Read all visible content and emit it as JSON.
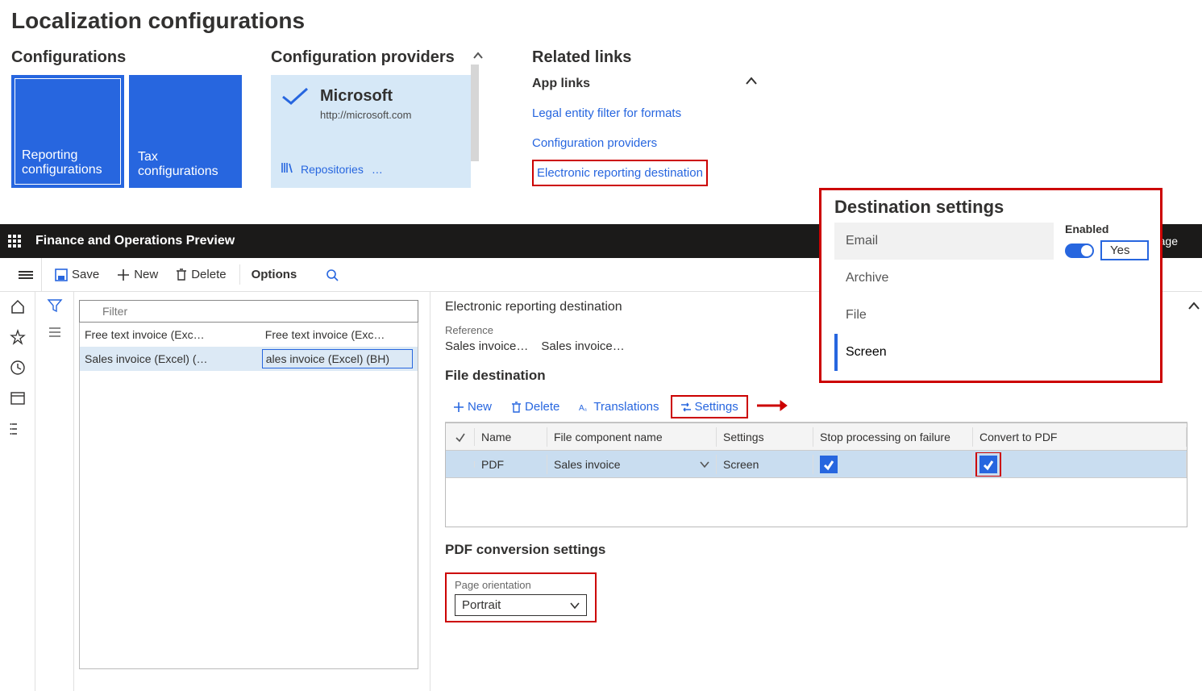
{
  "page_title": "Localization configurations",
  "sections": {
    "configs": {
      "title": "Configurations",
      "tiles": [
        {
          "label": "Reporting configurations"
        },
        {
          "label": "Tax configurations"
        }
      ]
    },
    "providers": {
      "title": "Configuration providers",
      "card": {
        "name": "Microsoft",
        "url": "http://microsoft.com",
        "repositories": "Repositories",
        "more": "…"
      }
    },
    "related": {
      "title": "Related links",
      "group": "App links",
      "items": [
        "Legal entity filter for formats",
        "Configuration providers",
        "Electronic reporting destination"
      ]
    }
  },
  "shell": {
    "app_name": "Finance and Operations Preview",
    "search_placeholder": "Search for a page"
  },
  "ribbon": {
    "save": "Save",
    "new": "New",
    "delete": "Delete",
    "options": "Options"
  },
  "list": {
    "filter_placeholder": "Filter",
    "rows": [
      {
        "c1": "Free text invoice (Exc…",
        "c2": "Free text invoice (Exc…",
        "selected": false
      },
      {
        "c1": "Sales invoice (Excel) (…",
        "c2": "ales invoice (Excel) (BH)",
        "selected": true
      }
    ]
  },
  "detail": {
    "title": "Electronic reporting destination",
    "reference_label": "Reference",
    "reference_values": [
      "Sales invoice…",
      "Sales invoice…"
    ],
    "file_dest_section": "File destination",
    "commands": {
      "new": "New",
      "delete": "Delete",
      "translations": "Translations",
      "settings": "Settings"
    },
    "grid": {
      "headers": {
        "name": "Name",
        "component": "File component name",
        "settings": "Settings",
        "stop": "Stop processing on failure",
        "pdf": "Convert to PDF"
      },
      "row": {
        "name": "PDF",
        "component": "Sales invoice",
        "settings": "Screen",
        "stop": true,
        "pdf": true
      }
    },
    "pdf_section": "PDF conversion settings",
    "orientation_label": "Page orientation",
    "orientation_value": "Portrait"
  },
  "popover": {
    "title": "Destination settings",
    "items": [
      "Email",
      "Archive",
      "File",
      "Screen"
    ],
    "enabled_label": "Enabled",
    "enabled_value": "Yes"
  }
}
